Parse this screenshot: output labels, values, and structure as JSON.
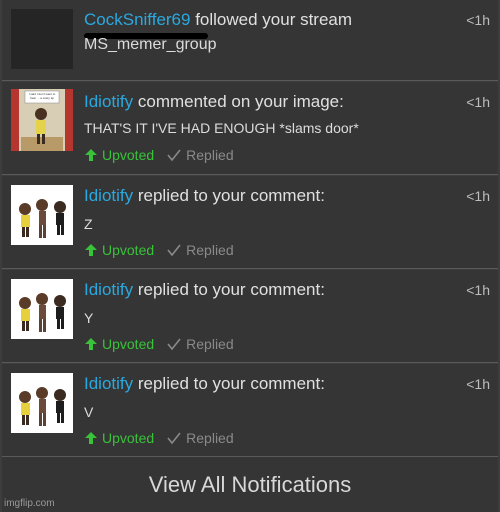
{
  "notifications": [
    {
      "user": "CockSniffer69",
      "action": " followed your stream",
      "detail": "MS_memer_group",
      "time": "<1h",
      "has_actions": false
    },
    {
      "user": "Idiotify",
      "action": " commented on your image:",
      "detail": "THAT'S IT I'VE HAD ENOUGH *slams door*",
      "time": "<1h",
      "has_actions": true
    },
    {
      "user": "Idiotify",
      "action": " replied to your comment:",
      "detail": "Z",
      "time": "<1h",
      "has_actions": true
    },
    {
      "user": "Idiotify",
      "action": " replied to your comment:",
      "detail": "Y",
      "time": "<1h",
      "has_actions": true
    },
    {
      "user": "Idiotify",
      "action": " replied to your comment:",
      "detail": "V",
      "time": "<1h",
      "has_actions": true
    }
  ],
  "actions": {
    "upvoted_label": "Upvoted",
    "replied_label": "Replied"
  },
  "footer": {
    "view_all_label": "View All Notifications"
  },
  "thumbnail_text": "I said I don't want to hear ... a crazy tip",
  "watermark": "imgflip.com",
  "colors": {
    "username": "#2aa9e0",
    "upvoted": "#39c23a",
    "background": "#353535"
  }
}
